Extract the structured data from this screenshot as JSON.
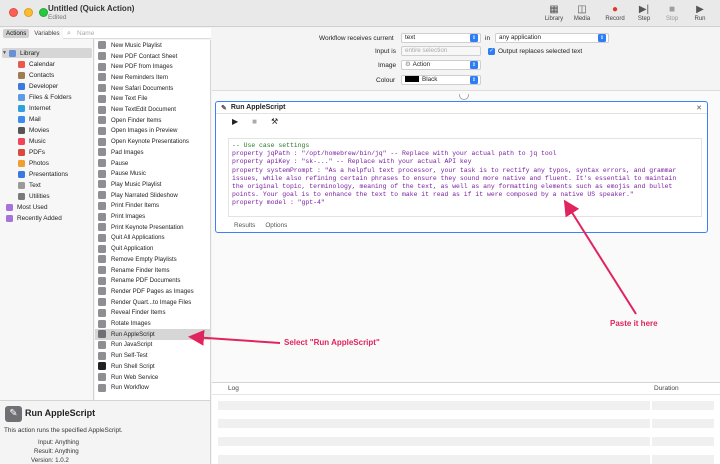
{
  "window": {
    "title": "Untitled (Quick Action)",
    "subtitle": "Edited",
    "toolbar": [
      "Library",
      "Media",
      "Record",
      "Step",
      "Stop",
      "Run"
    ]
  },
  "sidebar": {
    "tabs": [
      "Actions",
      "Variables"
    ],
    "search_placeholder": "Name",
    "library_label": "Library",
    "items": [
      "Calendar",
      "Contacts",
      "Developer",
      "Files & Folders",
      "Internet",
      "Mail",
      "Movies",
      "Music",
      "PDFs",
      "Photos",
      "Presentations",
      "Text",
      "Utilities"
    ],
    "most_used": "Most Used",
    "recently_added": "Recently Added"
  },
  "actions": [
    "New Music Playlist",
    "New PDF Contact Sheet",
    "New PDF from Images",
    "New Reminders Item",
    "New Safari Documents",
    "New Text File",
    "New TextEdit Document",
    "Open Finder Items",
    "Open Images in Preview",
    "Open Keynote Presentations",
    "Pad Images",
    "Pause",
    "Pause Music",
    "Play Music Playlist",
    "Play Narrated Slideshow",
    "Print Finder Items",
    "Print Images",
    "Print Keynote Presentation",
    "Quit All Applications",
    "Quit Application",
    "Remove Empty Playlists",
    "Rename Finder Items",
    "Rename PDF Documents",
    "Render PDF Pages as Images",
    "Render Quart...to Image Files",
    "Reveal Finder Items",
    "Rotate Images",
    "Run AppleScript",
    "Run JavaScript",
    "Run Self-Test",
    "Run Shell Script",
    "Run Web Service",
    "Run Workflow"
  ],
  "workflow": {
    "receives_label": "Workflow receives current",
    "receives_value": "text",
    "in_label": "in",
    "in_value": "any application",
    "input_is_label": "Input is",
    "input_is_value": "entire selection",
    "replace_label": "Output replaces selected text",
    "image_label": "Image",
    "image_value": "Action",
    "colour_label": "Colour",
    "colour_value": "Black"
  },
  "action_card": {
    "title": "Run AppleScript",
    "code": [
      "-- Use case settings",
      "property jqPath : \"/opt/homebrew/bin/jq\" -- Replace with your actual path to jq tool",
      "property apiKey : \"sk-...\" -- Replace with your actual API key",
      "property systemPrompt : \"As a helpful text processor, your task is to rectify any typos, syntax errors, and grammar",
      "issues, while also refining certain phrases to ensure they sound more native and fluent. It's essential to maintain",
      "the original topic, terminology, meaning of the text, as well as any formatting elements such as emojis and bullet",
      "points. Your goal is to enhance the text to make it read as if it were composed by a native US speaker.\"",
      "property model : \"gpt-4\""
    ],
    "footer_tabs": [
      "Results",
      "Options"
    ]
  },
  "log": {
    "log_header": "Log",
    "duration_header": "Duration"
  },
  "info": {
    "title": "Run AppleScript",
    "description": "This action runs the specified AppleScript.",
    "input_label": "Input:",
    "input_value": "Anything",
    "result_label": "Result:",
    "result_value": "Anything",
    "version_label": "Version:",
    "version_value": "1.0.2"
  },
  "annotations": {
    "select_hint": "Select \"Run AppleScript\"",
    "paste_hint": "Paste it here",
    "accent": "#e0245e"
  }
}
